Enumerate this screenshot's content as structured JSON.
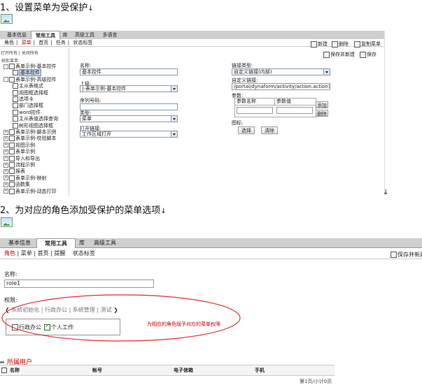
{
  "step1": {
    "title": "1、设置菜单为受保护",
    "arrow": "↓"
  },
  "step2": {
    "title": "2、为对应的角色添加受保护的菜单选项",
    "arrow": "↓"
  },
  "tail_arrow": "↓",
  "shot1": {
    "tabs": [
      "基本信息",
      "常用工具",
      "库",
      "高级工具",
      "多语言"
    ],
    "active_tab": "常用工具",
    "subnav": [
      "角色",
      "菜单",
      "首页",
      "任务",
      "状态标签"
    ],
    "subnav_seps": "|",
    "toolbar": {
      "new": "新建",
      "delete": "删除",
      "copy": "复制菜单",
      "save_new": "保存并新建",
      "save": "保存"
    },
    "tree_controls": "打开所有 | 关闭所有",
    "tree_root": "树形菜单",
    "tree": [
      {
        "label": "表单示例-基本控件",
        "indent": 1,
        "expand": "-"
      },
      {
        "label": "基本控件",
        "indent": 2,
        "selected": true
      },
      {
        "label": "表单示例-高级控件",
        "indent": 1,
        "expand": "-"
      },
      {
        "label": "主从表格式",
        "indent": 2
      },
      {
        "label": "视图框选择框",
        "indent": 2
      },
      {
        "label": "选项卡",
        "indent": 2
      },
      {
        "label": "部门选择框",
        "indent": 2
      },
      {
        "label": "word控件",
        "indent": 2
      },
      {
        "label": "主从表值选择查询",
        "indent": 2
      },
      {
        "label": "树形视图选择框",
        "indent": 2
      },
      {
        "label": "表单示例-脚本示例",
        "indent": 1,
        "expand": "+"
      },
      {
        "label": "表单示例-校验脚本",
        "indent": 1,
        "expand": "+"
      },
      {
        "label": "视图示例",
        "indent": 1,
        "expand": "+"
      },
      {
        "label": "表单示例",
        "indent": 1,
        "expand": "+"
      },
      {
        "label": "导入和导出",
        "indent": 1,
        "expand": "+"
      },
      {
        "label": "流程示例",
        "indent": 1,
        "expand": "+"
      },
      {
        "label": "报表",
        "indent": 1,
        "expand": "+"
      },
      {
        "label": "表单示例-映射",
        "indent": 1,
        "expand": "+"
      },
      {
        "label": "函数集",
        "indent": 1,
        "expand": "+"
      },
      {
        "label": "表单示例-动态打印",
        "indent": 1,
        "expand": "+"
      }
    ],
    "form": {
      "name_label": "名称:",
      "name_value": "基本控件",
      "parent_label": "上级:",
      "parent_value": "|-表单示例-基本控件",
      "order_label": "序列号码:",
      "order_value": "",
      "type_label": "类型:",
      "type_value": "菜单",
      "open_label": "打开链接:",
      "open_value": "工作区域打开",
      "link_type_label": "链接类型:",
      "link_type_value": "自定义链接(内部)",
      "custom_link_label": "自定义链接:",
      "custom_link_value": "/portal/dynaform/activity/action.action?_activityId",
      "params_label": "参数:",
      "param_name_header": "参数名称",
      "param_value_header": "参数值",
      "add_btn": "添加",
      "remove_btn": "删除",
      "icon_label": "图标:",
      "choose_btn": "选择",
      "clear_btn": "清除"
    }
  },
  "shot2": {
    "tabs": [
      "基本信息",
      "常用工具",
      "库",
      "高级工具"
    ],
    "active_tab": "常用工具",
    "subnav": [
      "角色",
      "菜单",
      "首页",
      "提醒",
      "状态标签"
    ],
    "save_new": "保存并新建",
    "name_label": "名称:",
    "name_value": "role1",
    "perm_label": "权限:",
    "perm_tabs": "系统初始化 | 行政办公 | 系统管理 | 测试",
    "perm_items": [
      {
        "label": "行政办公",
        "checked": false
      },
      {
        "label": "个人工作",
        "checked": true
      }
    ],
    "annotation": "为相应的角色赋予对应的菜单权限",
    "users_title": "所属用户",
    "table_headers": [
      "名称",
      "帐号",
      "电子信箱",
      "手机"
    ],
    "pager": "第1页/小计0页"
  },
  "colors": {
    "accent_red": "#cc0000",
    "tab_bar": "#cfcfcf",
    "ellipse": "#e23030"
  }
}
